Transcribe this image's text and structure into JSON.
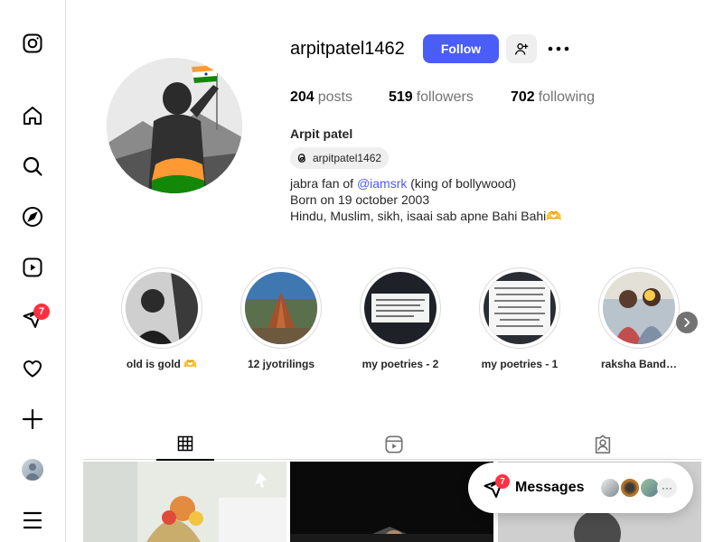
{
  "sidebar": {
    "items": [
      {
        "name": "instagram-logo-icon"
      },
      {
        "name": "home-icon"
      },
      {
        "name": "search-icon"
      },
      {
        "name": "explore-icon"
      },
      {
        "name": "reels-icon"
      },
      {
        "name": "messenger-icon",
        "badge": "7"
      },
      {
        "name": "notifications-heart-icon"
      },
      {
        "name": "create-plus-icon"
      },
      {
        "name": "profile-avatar"
      },
      {
        "name": "menu-icon"
      }
    ]
  },
  "profile": {
    "username": "arpitpatel1462",
    "follow_label": "Follow",
    "stats": {
      "posts_count": "204",
      "posts_label": "posts",
      "followers_count": "519",
      "followers_label": "followers",
      "following_count": "702",
      "following_label": "following"
    },
    "full_name": "Arpit patel",
    "threads_handle": "arpitpatel1462",
    "bio": {
      "line1_prefix": "jabra fan of ",
      "line1_mention": "@iamsrk",
      "line1_suffix": " (king of bollywood)",
      "line2": "Born on 19 october 2003",
      "line3": "Hindu, Muslim, sikh, isaai sab apne Bahi Bahi🫶"
    }
  },
  "highlights": [
    {
      "label": "old is gold 🫶"
    },
    {
      "label": "12 jyotrilings"
    },
    {
      "label": "my poetries - 2"
    },
    {
      "label": "my poetries - 1"
    },
    {
      "label": "raksha Band…"
    }
  ],
  "tabs": [
    {
      "name": "posts-grid-icon",
      "active": true
    },
    {
      "name": "reels-icon",
      "active": false
    },
    {
      "name": "tagged-icon",
      "active": false
    }
  ],
  "messages": {
    "label": "Messages",
    "badge": "7",
    "more": "···"
  },
  "colors": {
    "accent": "#4a5df9",
    "badge": "#ff3040",
    "secondary_text": "#737373",
    "border": "#dbdbdb"
  }
}
